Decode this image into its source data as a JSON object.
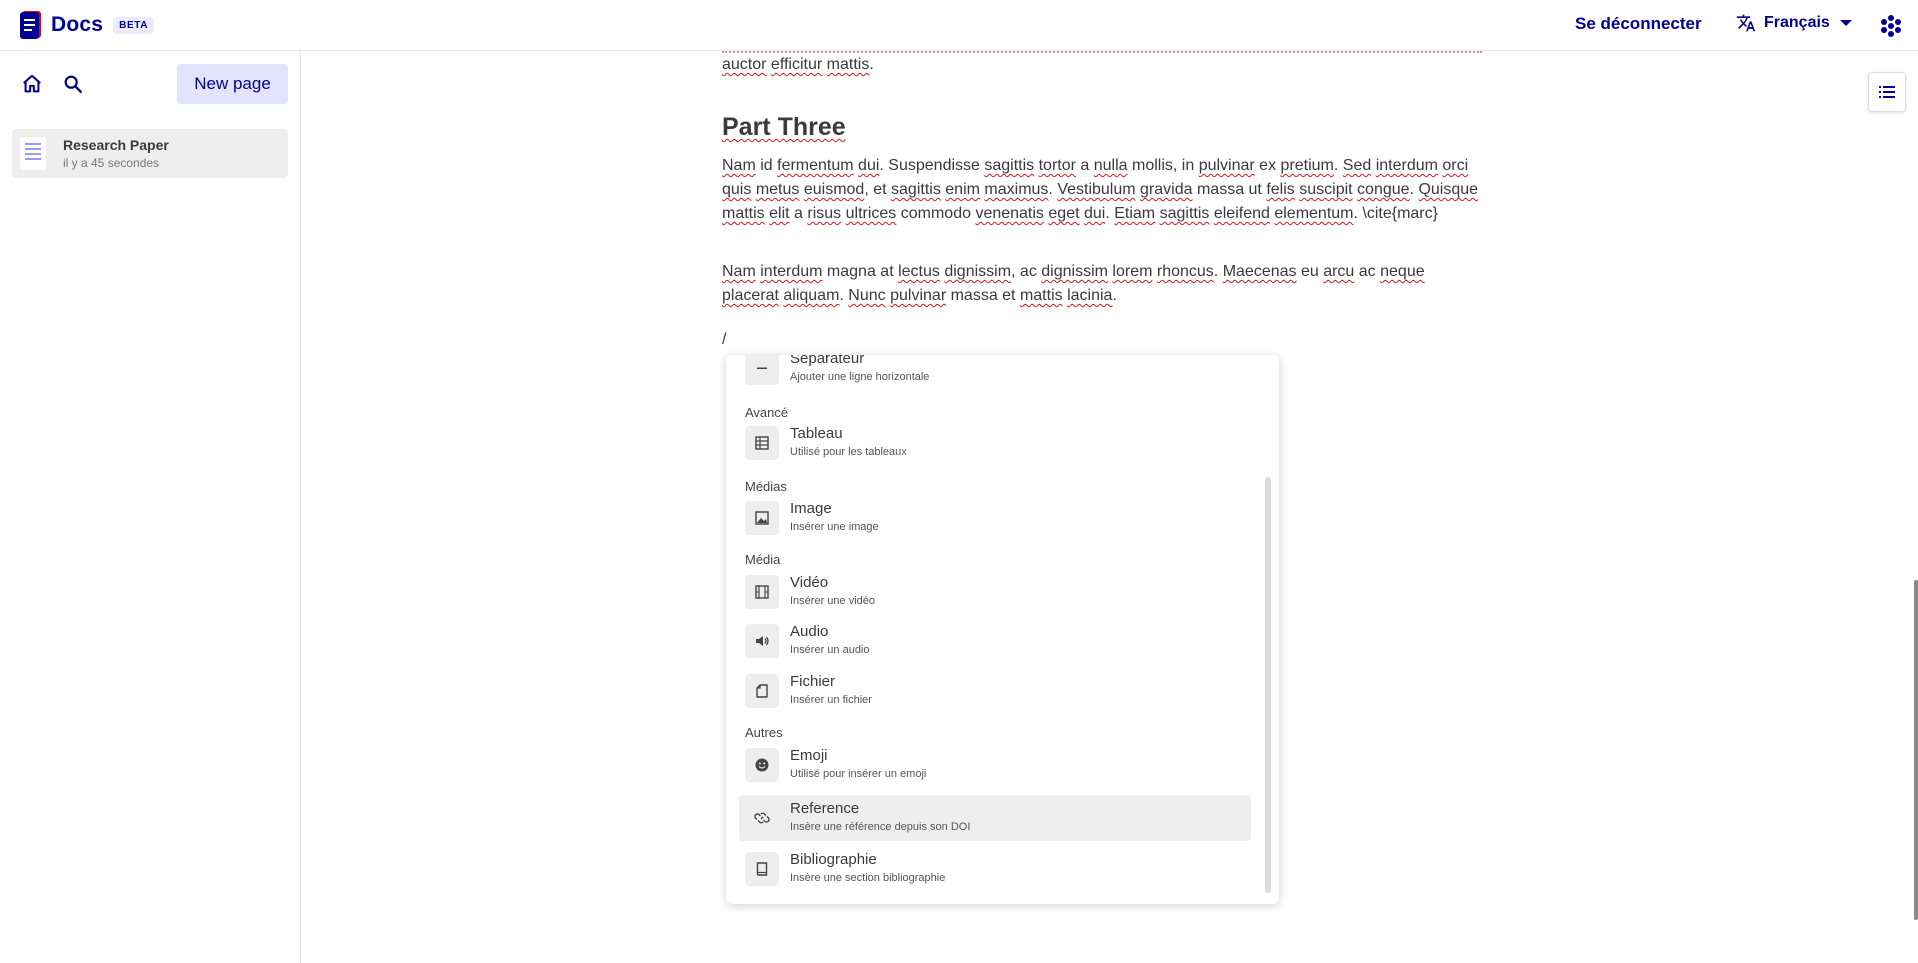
{
  "header": {
    "app_name": "Docs",
    "badge": "BETA",
    "logout_label": "Se déconnecter",
    "language_label": "Français"
  },
  "sidebar": {
    "new_page_label": "New page",
    "docs": [
      {
        "title": "Research Paper",
        "time": "il y a 45 secondes"
      }
    ]
  },
  "editor": {
    "top_line": "auctor efficitur mattis.",
    "heading": "Part Three",
    "slash": "/"
  },
  "menu": {
    "groups": {
      "advanced": "Avancé",
      "medias": "Médias",
      "media": "Média",
      "others": "Autres"
    },
    "items": [
      {
        "title": "Séparateur",
        "subtitle": "Ajouter une ligne horizontale",
        "icon": "horizontal-rule-icon"
      },
      {
        "title": "Tableau",
        "subtitle": "Utilisé pour les tableaux",
        "icon": "table-icon"
      },
      {
        "title": "Image",
        "subtitle": "Insérer une image",
        "icon": "image-icon"
      },
      {
        "title": "Vidéo",
        "subtitle": "Insérer une vidéo",
        "icon": "film-icon"
      },
      {
        "title": "Audio",
        "subtitle": "Insérer un audio",
        "icon": "volume-icon"
      },
      {
        "title": "Fichier",
        "subtitle": "Insérer un fichier",
        "icon": "file-icon"
      },
      {
        "title": "Emoji",
        "subtitle": "Utilisé pour insérer un emoji",
        "icon": "emoji-icon"
      },
      {
        "title": "Reference",
        "subtitle": "Insère une référence depuis son DOI",
        "icon": "link-icon"
      },
      {
        "title": "Bibliographie",
        "subtitle": "Insère une section bibliographie",
        "icon": "book-icon"
      }
    ]
  },
  "colors": {
    "brand": "#000091",
    "brand_light": "#e3e3fd",
    "hover": "#eeeeee",
    "spellcheck": "#d11a1a"
  }
}
